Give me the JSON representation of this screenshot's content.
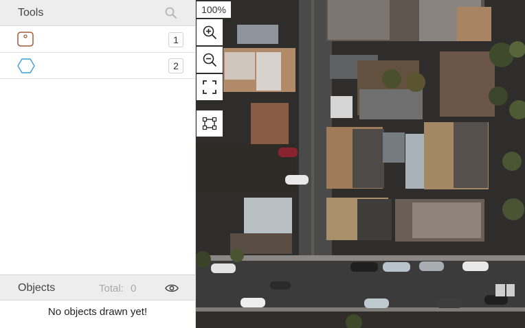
{
  "tools_panel": {
    "title": "Tools",
    "items": [
      {
        "icon": "rectangle-tool-icon",
        "shortcut": "1",
        "color": "#a35a36"
      },
      {
        "icon": "polygon-tool-icon",
        "shortcut": "2",
        "color": "#3aa0dc"
      }
    ]
  },
  "objects_panel": {
    "title": "Objects",
    "total_label": "Total:",
    "total_value": "0",
    "empty_message": "No objects drawn yet!"
  },
  "map_controls": {
    "zoom_level": "100%",
    "buttons": [
      "zoom-in-icon",
      "zoom-out-icon",
      "fit-screen-icon",
      "bounding-box-icon"
    ]
  }
}
